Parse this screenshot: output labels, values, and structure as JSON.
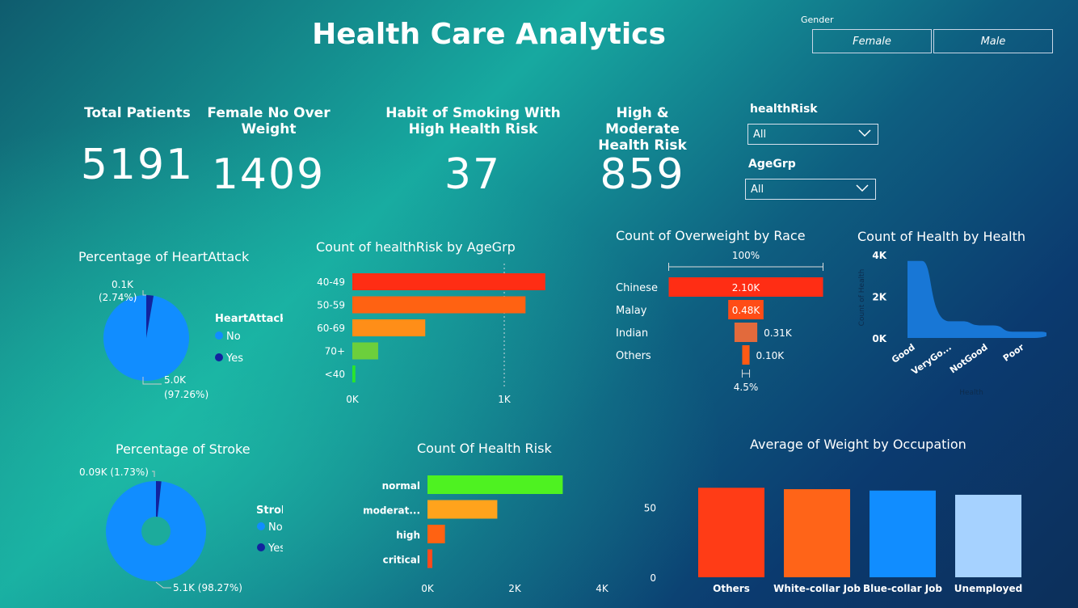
{
  "title": "Health Care Analytics",
  "gender_slicer": {
    "label": "Gender",
    "options": [
      "Female",
      "Male"
    ]
  },
  "kpis": [
    {
      "label": "Total Patients",
      "value": "5191"
    },
    {
      "label": "Female No Over Weight",
      "value": "1409"
    },
    {
      "label": "Habit of Smoking With High Health Risk",
      "value": "37"
    },
    {
      "label": "High & Moderate Health Risk",
      "value": "859"
    }
  ],
  "filters": {
    "healthRisk": {
      "label": "healthRisk",
      "value": "All"
    },
    "ageGrp": {
      "label": "AgeGrp",
      "value": "All"
    }
  },
  "colors": {
    "pie_no": "#118dff",
    "pie_yes": "#12239e",
    "accent": "#ff2d14"
  },
  "chart_data": [
    {
      "id": "heartattack",
      "type": "pie",
      "title": "Percentage of HeartAttack",
      "legend_title": "HeartAttack",
      "legend_position": "right",
      "slices": [
        {
          "label": "No",
          "value": 5.0,
          "display": "5.0K",
          "pct": "(97.26%)",
          "color": "#118dff"
        },
        {
          "label": "Yes",
          "value": 0.14,
          "display": "0.1K",
          "pct": "(2.74%)",
          "color": "#12239e"
        }
      ]
    },
    {
      "id": "healthrisk_agegrp",
      "type": "bar",
      "orientation": "horizontal",
      "title": "Count of healthRisk by AgeGrp",
      "categories": [
        "40-49",
        "50-59",
        "60-69",
        "70+",
        "<40"
      ],
      "values": [
        1270,
        1140,
        480,
        170,
        20
      ],
      "colors": [
        "#ff2d14",
        "#ff6212",
        "#ff8e18",
        "#6ccf3c",
        "#29e52c"
      ],
      "xticks": [
        "0K",
        "1K"
      ],
      "xlim": [
        0,
        1000
      ],
      "grid": true
    },
    {
      "id": "overweight_race",
      "type": "bar",
      "orientation": "horizontal",
      "title": "Count of Overweight by Race",
      "categories": [
        "Chinese",
        "Malay",
        "Indian",
        "Others"
      ],
      "values": [
        2.1,
        0.48,
        0.31,
        0.1
      ],
      "labels": [
        "2.10K",
        "0.48K",
        "0.31K",
        "0.10K"
      ],
      "colors": [
        "#ff2d14",
        "#ff4c16",
        "#e26a3c",
        "#ff5a14"
      ],
      "top_annotation": "100%",
      "bottom_annotation": "4.5%"
    },
    {
      "id": "health_by_health",
      "type": "area",
      "title": "Count of Health by Health",
      "categories": [
        "Good",
        "VeryGo...",
        "NotGood",
        "Poor"
      ],
      "values": [
        3700,
        800,
        600,
        300
      ],
      "yticks": [
        "0K",
        "2K",
        "4K"
      ],
      "ylim": [
        0,
        4000
      ],
      "ylabel": "Count of Health",
      "xlabel": "Health"
    },
    {
      "id": "stroke",
      "type": "pie",
      "title": "Percentage of Stroke",
      "legend_title": "Stroke",
      "legend_position": "right",
      "slices": [
        {
          "label": "No",
          "value": 5.1,
          "display": "5.1K",
          "pct": "(98.27%)",
          "color": "#118dff"
        },
        {
          "label": "Yes",
          "value": 0.09,
          "display": "0.09K",
          "pct": "(1.73%)",
          "color": "#12239e"
        }
      ]
    },
    {
      "id": "health_risk",
      "type": "bar",
      "orientation": "horizontal",
      "title": "Count Of Health Risk",
      "categories": [
        "normal",
        "moderat...",
        "high",
        "critical"
      ],
      "values": [
        3100,
        1600,
        400,
        110
      ],
      "colors": [
        "#4ef221",
        "#ffa31c",
        "#ff6212",
        "#ff4a1c"
      ],
      "xticks": [
        "0K",
        "2K",
        "4K"
      ],
      "xlim": [
        0,
        4000
      ]
    },
    {
      "id": "weight_occupation",
      "type": "bar",
      "orientation": "vertical",
      "title": "Average of Weight by Occupation",
      "categories": [
        "Others",
        "White-collar Job",
        "Blue-collar Job",
        "Unemployed"
      ],
      "values": [
        64,
        63,
        62,
        59
      ],
      "colors": [
        "#ff3c16",
        "#ff6418",
        "#118dff",
        "#a6d2ff"
      ],
      "yticks": [
        "0",
        "50"
      ],
      "ylim": [
        0,
        74
      ]
    }
  ]
}
